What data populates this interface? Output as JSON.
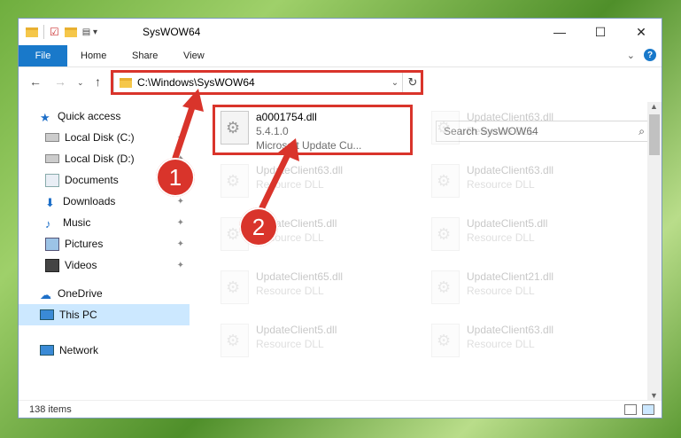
{
  "window": {
    "title": "SysWOW64",
    "controls": [
      "—",
      "☐",
      "✕"
    ]
  },
  "ribbon": {
    "file": "File",
    "tabs": [
      "Home",
      "Share",
      "View"
    ]
  },
  "address": {
    "path": "C:\\Windows\\SysWOW64",
    "search_placeholder": "Search SysWOW64"
  },
  "sidebar": {
    "items": [
      {
        "label": "Quick access",
        "icon": "star-icon"
      },
      {
        "label": "Local Disk (C:)",
        "icon": "drive-icon"
      },
      {
        "label": "Local Disk (D:)",
        "icon": "drive-icon"
      },
      {
        "label": "Documents",
        "icon": "documents-icon"
      },
      {
        "label": "Downloads",
        "icon": "download-icon"
      },
      {
        "label": "Music",
        "icon": "music-icon"
      },
      {
        "label": "Pictures",
        "icon": "pictures-icon"
      },
      {
        "label": "Videos",
        "icon": "videos-icon"
      },
      {
        "label": "OneDrive",
        "icon": "cloud-icon"
      },
      {
        "label": "This PC",
        "icon": "computer-icon"
      },
      {
        "label": "Network",
        "icon": "network-icon"
      }
    ]
  },
  "files": [
    {
      "name": "a0001754.dll",
      "sub1": "5.4.1.0",
      "sub2": "Microsoft Update Cu..."
    },
    {
      "name": "UpdateClient63.dll",
      "sub1": "Resource DLL"
    },
    {
      "name": "UpdateClient63.dll",
      "sub1": "Resource DLL"
    },
    {
      "name": "UpdateClient63.dll",
      "sub1": "Resource DLL"
    },
    {
      "name": "UpdateClient5.dll",
      "sub1": "Resource DLL"
    },
    {
      "name": "UpdateClient5.dll",
      "sub1": "Resource DLL"
    },
    {
      "name": "UpdateClient65.dll",
      "sub1": "Resource DLL"
    },
    {
      "name": "UpdateClient21.dll",
      "sub1": "Resource DLL"
    },
    {
      "name": "UpdateClient5.dll",
      "sub1": "Resource DLL"
    },
    {
      "name": "UpdateClient63.dll",
      "sub1": "Resource DLL"
    }
  ],
  "status": {
    "count": "138 items"
  },
  "annotations": {
    "badge1": "1",
    "badge2": "2",
    "color": "#d9342b"
  }
}
